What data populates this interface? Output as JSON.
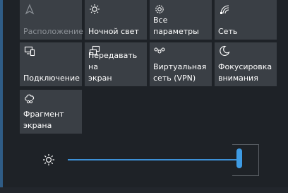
{
  "tiles": [
    {
      "label": "Расположение",
      "icon": "location-icon",
      "enabled": false
    },
    {
      "label": "Ночной свет",
      "icon": "night-light-icon",
      "enabled": true
    },
    {
      "label": "Все\nпараметры",
      "icon": "gear-icon",
      "enabled": true
    },
    {
      "label": "Сеть",
      "icon": "network-icon",
      "enabled": true
    },
    {
      "label": "Подключение",
      "icon": "connect-icon",
      "enabled": true
    },
    {
      "label": "Передавать на\nэкран",
      "icon": "project-icon",
      "enabled": true
    },
    {
      "label": "Виртуальная\nсеть (VPN)",
      "icon": "vpn-icon",
      "enabled": true
    },
    {
      "label": "Фокусировка\nвнимания",
      "icon": "focus-assist-icon",
      "enabled": true
    },
    {
      "label": "Фрагмент\nэкрана",
      "icon": "screen-snip-icon",
      "enabled": true
    }
  ],
  "brightness": {
    "icon": "brightness-icon",
    "level": 1.0
  },
  "colors": {
    "tile_bg": "#3a3f45",
    "panel_bg": "#1e2227",
    "accent": "#3e9be4",
    "disabled_text": "#8b9096"
  }
}
